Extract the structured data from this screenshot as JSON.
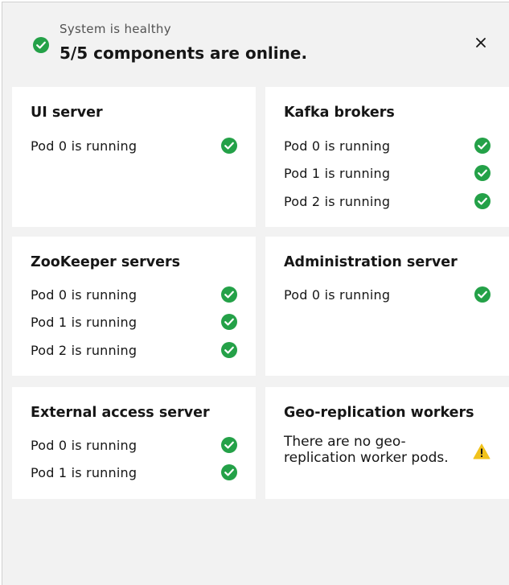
{
  "header": {
    "status_subtitle": "System is healthy",
    "status_title": "5/5 components are online."
  },
  "colors": {
    "success": "#24a148",
    "warning": "#f1c21b",
    "card_background": "#ffffff",
    "panel_background": "#f2f2f2"
  },
  "components": [
    {
      "title": "UI server",
      "pods": [
        {
          "label": "Pod 0 is running",
          "status": "checkmark-filled-icon"
        }
      ]
    },
    {
      "title": "Kafka brokers",
      "pods": [
        {
          "label": "Pod 0 is running",
          "status": "checkmark-filled-icon"
        },
        {
          "label": "Pod 1 is running",
          "status": "checkmark-filled-icon"
        },
        {
          "label": "Pod 2 is running",
          "status": "checkmark-filled-icon"
        }
      ]
    },
    {
      "title": "ZooKeeper servers",
      "pods": [
        {
          "label": "Pod 0 is running",
          "status": "checkmark-filled-icon"
        },
        {
          "label": "Pod 1 is running",
          "status": "checkmark-filled-icon"
        },
        {
          "label": "Pod 2 is running",
          "status": "checkmark-filled-icon"
        }
      ]
    },
    {
      "title": "Administration server",
      "pods": [
        {
          "label": "Pod 0 is running",
          "status": "checkmark-filled-icon"
        }
      ]
    },
    {
      "title": "External access server",
      "pods": [
        {
          "label": "Pod 0 is running",
          "status": "checkmark-filled-icon"
        },
        {
          "label": "Pod 1 is running",
          "status": "checkmark-filled-icon"
        }
      ]
    },
    {
      "title": "Geo-replication workers",
      "note": "There are no geo-replication worker pods.",
      "status": "warning-icon"
    }
  ]
}
